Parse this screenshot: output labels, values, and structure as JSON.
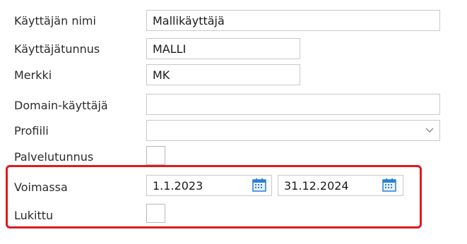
{
  "form": {
    "username": {
      "label": "Käyttäjän nimi",
      "value": "Mallikäyttäjä"
    },
    "user_id": {
      "label": "Käyttäjätunnus",
      "value": "MALLI"
    },
    "mark": {
      "label": "Merkki",
      "value": "MK"
    },
    "domain_user": {
      "label": "Domain-käyttäjä",
      "value": ""
    },
    "profile": {
      "label": "Profiili",
      "value": ""
    },
    "service_id": {
      "label": "Palvelutunnus",
      "checked": false
    },
    "valid": {
      "label": "Voimassa",
      "start": "1.1.2023",
      "end": "31.12.2024"
    },
    "locked": {
      "label": "Lukittu",
      "checked": false
    }
  },
  "colors": {
    "highlight": "#e0191c",
    "calendar_icon": "#2a7fd4"
  },
  "icons": {
    "select_arrow": "chevron-down-icon",
    "date_picker": "calendar-icon"
  }
}
